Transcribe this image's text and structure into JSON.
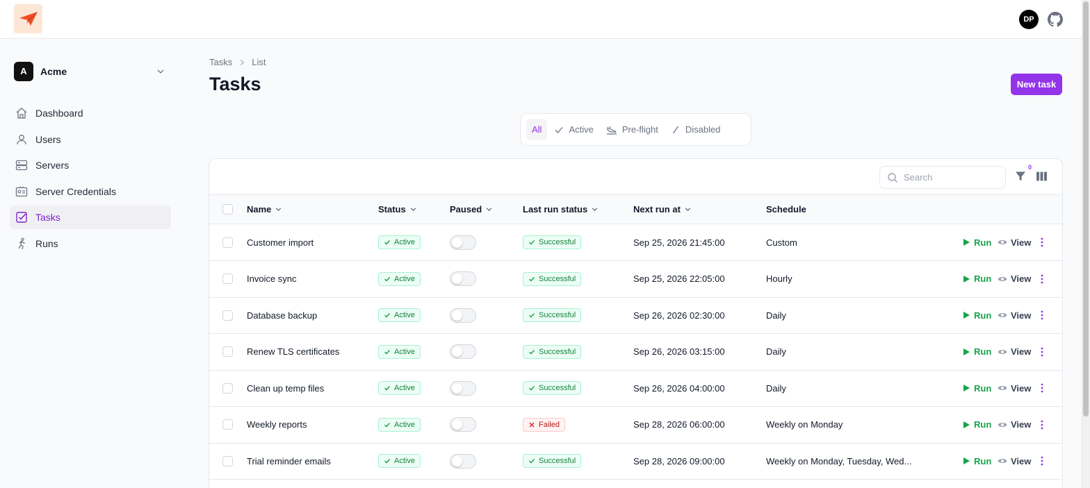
{
  "app": {
    "logo": "paper-plane-logo",
    "user_initials": "DP"
  },
  "team": {
    "initial": "A",
    "name": "Acme"
  },
  "sidebar": {
    "items": [
      {
        "label": "Dashboard",
        "icon": "home-icon",
        "active": false
      },
      {
        "label": "Users",
        "icon": "user-icon",
        "active": false
      },
      {
        "label": "Servers",
        "icon": "server-icon",
        "active": false
      },
      {
        "label": "Server Credentials",
        "icon": "id-card-icon",
        "active": false
      },
      {
        "label": "Tasks",
        "icon": "checkbox-icon",
        "active": true
      },
      {
        "label": "Runs",
        "icon": "runner-icon",
        "active": false
      }
    ]
  },
  "breadcrumb": {
    "first": "Tasks",
    "second": "List"
  },
  "page": {
    "title": "Tasks",
    "new_button": "New task"
  },
  "tabs": [
    {
      "label": "All",
      "active": true
    },
    {
      "label": "Active",
      "icon": "check-icon"
    },
    {
      "label": "Pre-flight",
      "icon": "plane-landing-icon"
    },
    {
      "label": "Disabled",
      "icon": "slash-icon"
    }
  ],
  "toolbar": {
    "search_placeholder": "Search",
    "filter_count": "0"
  },
  "table": {
    "columns": [
      "Name",
      "Status",
      "Paused",
      "Last run status",
      "Next run at",
      "Schedule"
    ],
    "rows": [
      {
        "name": "Customer import",
        "status": "Active",
        "paused": false,
        "last_run": "Successful",
        "next_run": "Sep 25, 2026 21:45:00",
        "schedule": "Custom"
      },
      {
        "name": "Invoice sync",
        "status": "Active",
        "paused": false,
        "last_run": "Successful",
        "next_run": "Sep 25, 2026 22:05:00",
        "schedule": "Hourly"
      },
      {
        "name": "Database backup",
        "status": "Active",
        "paused": false,
        "last_run": "Successful",
        "next_run": "Sep 26, 2026 02:30:00",
        "schedule": "Daily"
      },
      {
        "name": "Renew TLS certificates",
        "status": "Active",
        "paused": false,
        "last_run": "Successful",
        "next_run": "Sep 26, 2026 03:15:00",
        "schedule": "Daily"
      },
      {
        "name": "Clean up temp files",
        "status": "Active",
        "paused": false,
        "last_run": "Successful",
        "next_run": "Sep 26, 2026 04:00:00",
        "schedule": "Daily"
      },
      {
        "name": "Weekly reports",
        "status": "Active",
        "paused": false,
        "last_run": "Failed",
        "next_run": "Sep 28, 2026 06:00:00",
        "schedule": "Weekly on Monday"
      },
      {
        "name": "Trial reminder emails",
        "status": "Active",
        "paused": false,
        "last_run": "Successful",
        "next_run": "Sep 28, 2026 09:00:00",
        "schedule": "Weekly on Monday, Tuesday, Wed..."
      }
    ],
    "actions": {
      "run": "Run",
      "view": "View"
    }
  },
  "colors": {
    "accent": "#9333ea",
    "success": "#16a34a",
    "danger": "#dc2626"
  }
}
